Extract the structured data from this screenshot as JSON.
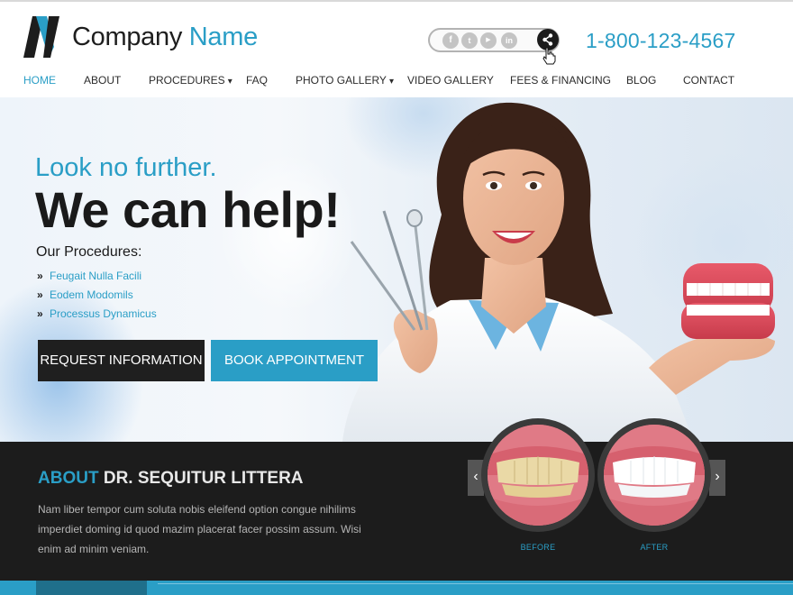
{
  "brand": {
    "name_part1": "Company",
    "name_part2": "Name",
    "logo_letter": "N"
  },
  "header": {
    "social": [
      {
        "icon": "facebook-icon",
        "glyph": "f"
      },
      {
        "icon": "twitter-icon",
        "glyph": "t"
      },
      {
        "icon": "youtube-icon",
        "glyph": "▶"
      },
      {
        "icon": "linkedin-icon",
        "glyph": "in"
      }
    ],
    "phone": "1-800-123-4567"
  },
  "nav": [
    {
      "label": "HOME",
      "active": true,
      "dropdown": false
    },
    {
      "label": "ABOUT",
      "active": false,
      "dropdown": false
    },
    {
      "label": "PROCEDURES",
      "active": false,
      "dropdown": true
    },
    {
      "label": "FAQ",
      "active": false,
      "dropdown": false
    },
    {
      "label": "PHOTO GALLERY",
      "active": false,
      "dropdown": true
    },
    {
      "label": "VIDEO GALLERY",
      "active": false,
      "dropdown": false
    },
    {
      "label": "FEES & FINANCING",
      "active": false,
      "dropdown": false
    },
    {
      "label": "BLOG",
      "active": false,
      "dropdown": false
    },
    {
      "label": "CONTACT",
      "active": false,
      "dropdown": false
    }
  ],
  "hero": {
    "tagline": "Look no further.",
    "headline": "We can help!",
    "procedures_title": "Our Procedures:",
    "procedures": [
      "Feugait Nulla Facili",
      "Eodem Modomils",
      "Processus Dynamicus"
    ],
    "bullet": "»",
    "request_button": "REQUEST INFORMATION",
    "book_button": "BOOK APPOINTMENT"
  },
  "about": {
    "title_accent": "ABOUT",
    "title_rest": " DR. SEQUITUR LITTERA",
    "text": "Nam liber tempor cum soluta nobis eleifend option congue nihilims imperdiet doming id quod mazim placerat facer possim assum. Wisi enim ad minim veniam.",
    "before_label": "BEFORE",
    "after_label": "AFTER",
    "prev_glyph": "‹",
    "next_glyph": "›"
  },
  "colors": {
    "accent": "#2a9ec6",
    "dark": "#1c1c1c",
    "button_dark": "#1f1f1f"
  }
}
